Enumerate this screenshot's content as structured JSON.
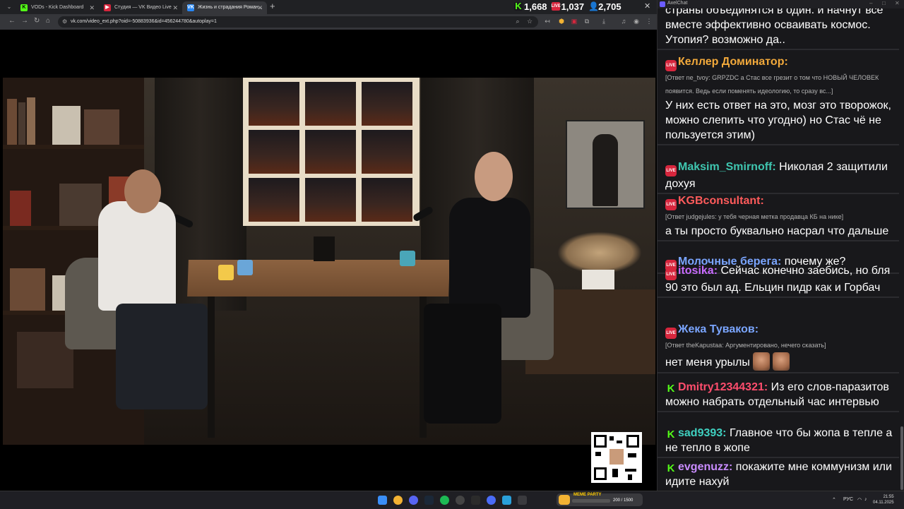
{
  "browser": {
    "tabs": [
      {
        "label": "VODs - Kick Dashboard",
        "favicon": "kick",
        "active": false
      },
      {
        "label": "Студия — VK Видео Live",
        "favicon": "vk-live",
        "active": false
      },
      {
        "label": "Жизнь и страдания Роман...",
        "favicon": "vk",
        "active": true
      }
    ],
    "url": "vk.com/video_ext.php?oid=-50883936&id=456244780&autoplay=1"
  },
  "stats": {
    "kick_viewers": "1,668",
    "vk_viewers": "1,037",
    "total_viewers": "2,705"
  },
  "colors": {
    "kick": "#53fc18",
    "live": "#d7263d",
    "accent": "#6b5cff"
  },
  "chat": {
    "window_title": "AxelChat",
    "messages": [
      {
        "platform": "none",
        "user": "",
        "user_color": "#ffffff",
        "reply": "",
        "text": "страны объединятся в один. и начнут все вместе эффективно осваивать космос. Утопия? возможно да..",
        "emotes": 0
      },
      {
        "platform": "live",
        "user": "Келлер Доминатор:",
        "user_color": "#f2a93b",
        "reply": "[Ответ ne_tvoy: GRPZDC а Стас все грезит о том что НОВЫЙ ЧЕЛОВЕК появится. Ведь если поменять идеологию, то сразу вс...]",
        "text": "У них есть ответ на это, мозг это творожок, можно слепить что угодно) но Стас чё не пользуется этим)",
        "emotes": 0
      },
      {
        "platform": "live",
        "user": "Maksim_Smirnoff:",
        "user_color": "#3fc6b0",
        "reply": "",
        "text": "Николая 2 защитили дохуя",
        "emotes": 0
      },
      {
        "platform": "live",
        "user": "KGBconsultant:",
        "user_color": "#ff5b5b",
        "reply": "[Ответ judgejules: у тебя черная метка продавца КБ на нике]",
        "text": "а ты просто буквально насрал что дальше",
        "emotes": 0
      },
      {
        "platform": "live",
        "user": "Молочные берега:",
        "user_color": "#7aa5ff",
        "reply": "",
        "text": "почему же?",
        "emotes": 0
      },
      {
        "platform": "live",
        "user": "itosika:",
        "user_color": "#c86bff",
        "reply": "",
        "text": "Сейчас конечно заебись, но бля 90 это был ад. Ельцин пидр как и Горбач",
        "emotes": 0
      },
      {
        "platform": "live",
        "user": "Жека Туваков:",
        "user_color": "#7aa5ff",
        "reply": "[Ответ theKapustaa: Аргументировано, нечего сказать]",
        "text": "нет меня урылы",
        "emotes": 2
      },
      {
        "platform": "kick",
        "user": "Dmitry12344321:",
        "user_color": "#ff4d6d",
        "reply": "",
        "text": "Из его слов-паразитов можно набрать отдельный час интервью",
        "emotes": 0
      },
      {
        "platform": "kick",
        "user": "sad9393:",
        "user_color": "#3fd0c0",
        "reply": "",
        "text": "Главное что бы жопа в тепле а не тепло в жопе",
        "emotes": 0
      },
      {
        "platform": "kick",
        "user": "evgenuzz:",
        "user_color": "#c98cff",
        "reply": "",
        "text": "покажите мне коммунизм или идите нахуй",
        "emotes": 0
      }
    ]
  },
  "taskbar": {
    "meme_party_label": "MEME PARTY",
    "meme_party_count": "200 / 1500",
    "language": "РУС",
    "time": "21:55",
    "date": "04.11.2025"
  }
}
